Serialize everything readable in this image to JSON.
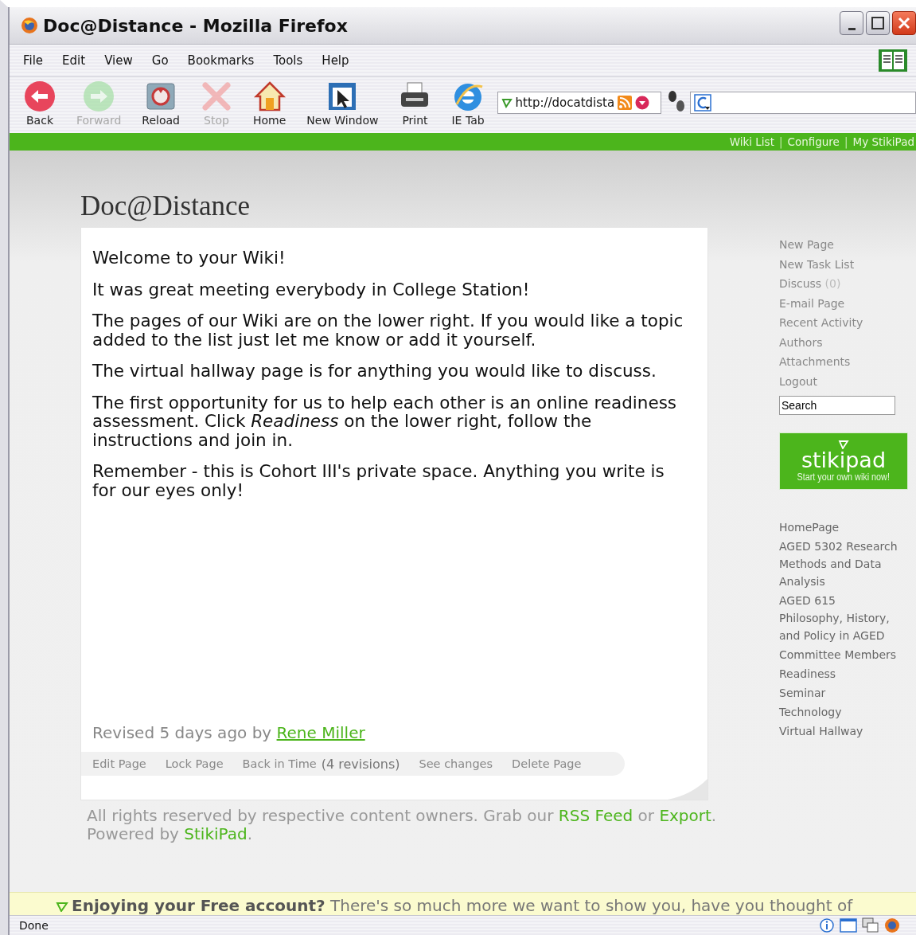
{
  "window": {
    "title": "Doc@Distance - Mozilla Firefox"
  },
  "menu": [
    "File",
    "Edit",
    "View",
    "Go",
    "Bookmarks",
    "Tools",
    "Help"
  ],
  "toolbar": [
    {
      "kind": "back",
      "label": "Back",
      "disabled": false
    },
    {
      "kind": "forward",
      "label": "Forward",
      "disabled": true
    },
    {
      "kind": "reload",
      "label": "Reload",
      "disabled": false
    },
    {
      "kind": "stop",
      "label": "Stop",
      "disabled": true
    },
    {
      "kind": "home",
      "label": "Home",
      "disabled": false
    },
    {
      "kind": "newwindow",
      "label": "New Window",
      "disabled": false
    },
    {
      "kind": "print",
      "label": "Print",
      "disabled": false
    },
    {
      "kind": "ietab",
      "label": "IE Tab",
      "disabled": false
    }
  ],
  "address": {
    "value": "http://docatdista"
  },
  "top_links": [
    "Wiki List",
    "Configure",
    "My StikiPad"
  ],
  "top_links_separator": "|",
  "page": {
    "title": "Doc@Distance",
    "paragraphs": [
      "Welcome to your Wiki!",
      "It was great meeting everybody in College Station!",
      "The pages of our Wiki are on the lower right. If you would like a topic added to the list just let me know or add it yourself.",
      "The virtual hallway page is for anything you would like to discuss.",
      "The first opportunity for us to help each other is an online readiness assessment. Click *Readiness* on the lower right, follow the instructions and join in.",
      "Remember - this is Cohort III's private space. Anything you write is for our eyes only!"
    ],
    "revised": {
      "text": "Revised 5 days ago by",
      "author": "Rene Miller"
    },
    "actions": [
      {
        "kind": "link",
        "label": "Edit Page"
      },
      {
        "kind": "link",
        "label": "Lock Page"
      },
      {
        "kind": "link",
        "label": "Back in Time"
      },
      {
        "kind": "note",
        "label": "(4 revisions)"
      },
      {
        "kind": "link",
        "label": "See changes"
      },
      {
        "kind": "link",
        "label": "Delete Page"
      }
    ]
  },
  "sidebar": {
    "actions": [
      {
        "label": "New Page"
      },
      {
        "label": "New Task List"
      },
      {
        "label": "Discuss",
        "count": "(0)"
      },
      {
        "label": "E-mail Page"
      },
      {
        "label": "Recent Activity"
      },
      {
        "label": "Authors"
      },
      {
        "label": "Attachments"
      },
      {
        "label": "Logout"
      }
    ],
    "search": {
      "value": "Search"
    },
    "promo": {
      "logo": "stikipad",
      "tagline": "Start your own wiki now!"
    },
    "pages": [
      "HomePage",
      "AGED 5302 Research Methods and Data Analysis",
      "AGED 615 Philosophy, History, and Policy in AGED",
      "Committee Members",
      "Readiness",
      "Seminar",
      "Technology",
      "Virtual Hallway"
    ]
  },
  "footer": [
    {
      "kind": "text",
      "text": "All rights reserved by respective content owners. Grab our "
    },
    {
      "kind": "link",
      "text": "RSS Feed"
    },
    {
      "kind": "text",
      "text": " or "
    },
    {
      "kind": "link",
      "text": "Export"
    },
    {
      "kind": "text",
      "text": ". Powered by "
    },
    {
      "kind": "link",
      "text": "StikiPad"
    },
    {
      "kind": "text",
      "text": "."
    }
  ],
  "banner": {
    "text": "**Enjoying your Free account?** There's so much more we want to show you, have you thought of"
  },
  "status_bar": {
    "text": "Done"
  }
}
